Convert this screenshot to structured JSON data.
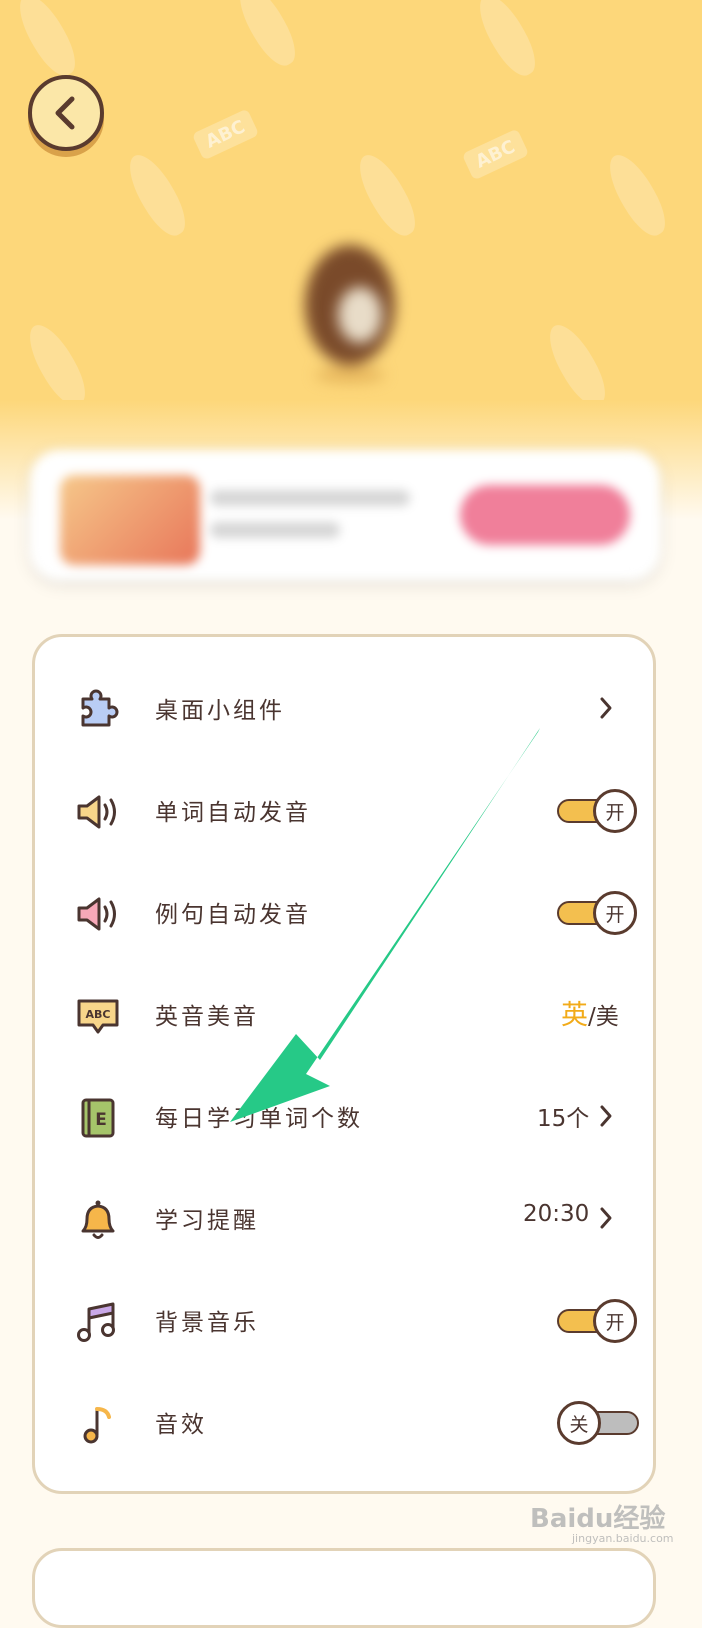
{
  "header": {
    "back_icon": "chevron-left-icon"
  },
  "settings": [
    {
      "id": "widget",
      "label": "桌面小组件",
      "icon": "puzzle-icon",
      "control": "chevron"
    },
    {
      "id": "word-audio",
      "label": "单词自动发音",
      "icon": "speaker-icon",
      "control": "toggle",
      "state": "on",
      "toggle_text": "开"
    },
    {
      "id": "sentence-audio",
      "label": "例句自动发音",
      "icon": "speaker-pink-icon",
      "control": "toggle",
      "state": "on",
      "toggle_text": "开"
    },
    {
      "id": "accent",
      "label": "英音美音",
      "icon": "abc-bubble-icon",
      "control": "accent",
      "selected": "英",
      "separator": "/",
      "other": "美"
    },
    {
      "id": "daily-words",
      "label": "每日学习单词个数",
      "icon": "book-icon",
      "control": "value",
      "value": "15个"
    },
    {
      "id": "reminder",
      "label": "学习提醒",
      "icon": "bell-icon",
      "control": "value",
      "value": "20:30"
    },
    {
      "id": "bg-music",
      "label": "背景音乐",
      "icon": "music-notes-icon",
      "control": "toggle",
      "state": "on",
      "toggle_text": "开"
    },
    {
      "id": "sound-fx",
      "label": "音效",
      "icon": "music-note-icon",
      "control": "toggle",
      "state": "off",
      "toggle_text": "关"
    }
  ],
  "watermark": {
    "brand": "Baidu经验",
    "sub": "jingyan.baidu.com"
  },
  "colors": {
    "accent": "#f2ab19",
    "toggle_on": "#f3bf4f",
    "toggle_off": "#bdbdbd",
    "arrow": "#26c987",
    "header": "#fdd77a"
  }
}
